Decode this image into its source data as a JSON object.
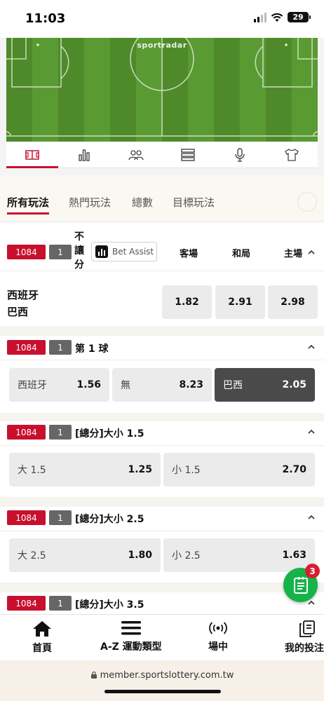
{
  "status_bar": {
    "time": "11:03",
    "battery": "29"
  },
  "pitch": {
    "brand": "sportradar"
  },
  "icon_tabs": [
    {
      "icon": "pitch-icon"
    },
    {
      "icon": "bar-chart-icon"
    },
    {
      "icon": "lineup-icon"
    },
    {
      "icon": "list-icon"
    },
    {
      "icon": "microphone-icon"
    },
    {
      "icon": "jersey-icon"
    }
  ],
  "market_tabs": [
    "所有玩法",
    "熱門玩法",
    "總數",
    "目標玩法"
  ],
  "market1": {
    "code": "1084",
    "num": "1",
    "title": "不讓分",
    "bet_assist": "Bet Assist",
    "col_away": "客場",
    "col_draw": "和局",
    "col_home": "主場",
    "team1": "西班牙",
    "team2": "巴西",
    "odds": [
      "1.82",
      "2.91",
      "2.98"
    ]
  },
  "market2": {
    "code": "1084",
    "num": "1",
    "title": "第 1 球",
    "options": [
      {
        "label": "西班牙",
        "value": "1.56"
      },
      {
        "label": "無",
        "value": "8.23"
      },
      {
        "label": "巴西",
        "value": "2.05"
      }
    ]
  },
  "market3": {
    "code": "1084",
    "num": "1",
    "title": "[總分]大小 1.5",
    "options": [
      {
        "label": "大 1.5",
        "value": "1.25"
      },
      {
        "label": "小 1.5",
        "value": "2.70"
      }
    ]
  },
  "market4": {
    "code": "1084",
    "num": "1",
    "title": "[總分]大小 2.5",
    "options": [
      {
        "label": "大 2.5",
        "value": "1.80"
      },
      {
        "label": "小 2.5",
        "value": "1.63"
      }
    ]
  },
  "market5": {
    "code": "1084",
    "num": "1",
    "title": "[總分]大小 3.5"
  },
  "fab": {
    "badge": "3"
  },
  "bottom_nav": [
    {
      "label": "首頁",
      "icon": "home-icon"
    },
    {
      "label": "A-Z 運動類型",
      "icon": "menu-icon"
    },
    {
      "label": "場中",
      "icon": "live-icon"
    },
    {
      "label": "我的投注",
      "icon": "bets-icon"
    }
  ],
  "url": "member.sportslottery.com.tw",
  "colors": {
    "accent": "#c8102e",
    "selected": "#4a4a4a",
    "fab": "#16b34a"
  }
}
